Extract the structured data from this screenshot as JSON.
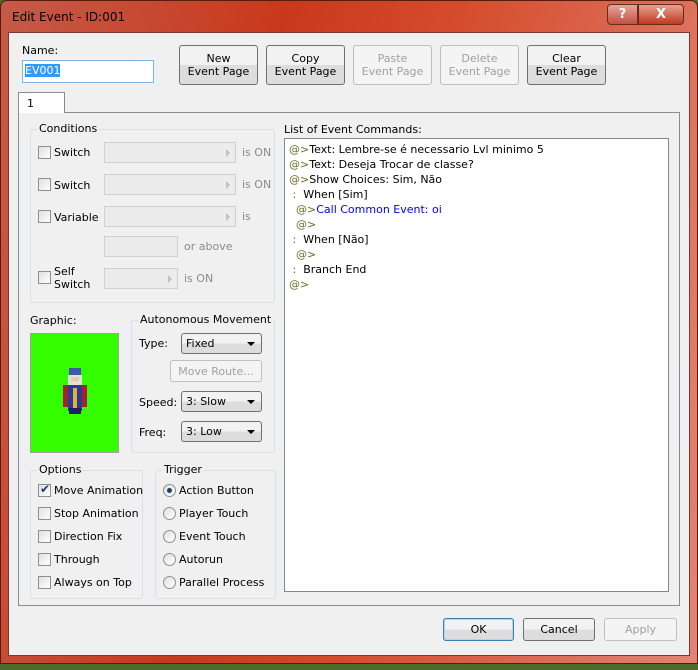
{
  "window": {
    "title": "Edit Event - ID:001",
    "help": "?",
    "close": "X"
  },
  "name": {
    "label": "Name:",
    "value": "EV001"
  },
  "toolbar": [
    {
      "l1": "New",
      "l2": "Event Page",
      "enabled": true
    },
    {
      "l1": "Copy",
      "l2": "Event Page",
      "enabled": true
    },
    {
      "l1": "Paste",
      "l2": "Event Page",
      "enabled": false
    },
    {
      "l1": "Delete",
      "l2": "Event Page",
      "enabled": false
    },
    {
      "l1": "Clear",
      "l2": "Event Page",
      "enabled": true
    }
  ],
  "tabs": [
    {
      "label": "1"
    }
  ],
  "conditions": {
    "title": "Conditions",
    "switch1": "Switch",
    "switch2": "Switch",
    "variable": "Variable",
    "is_on": "is ON",
    "is": "is",
    "or_above": "or above",
    "self_switch_1": "Self",
    "self_switch_2": "Switch"
  },
  "graphic": {
    "label": "Graphic:",
    "bg_color": "#33ff00"
  },
  "movement": {
    "title": "Autonomous Movement",
    "type_label": "Type:",
    "type": "Fixed",
    "move_route": "Move Route...",
    "speed_label": "Speed:",
    "speed": "3: Slow",
    "freq_label": "Freq:",
    "freq": "3: Low"
  },
  "options": {
    "title": "Options",
    "items": [
      {
        "label": "Move Animation",
        "checked": true
      },
      {
        "label": "Stop Animation",
        "checked": false
      },
      {
        "label": "Direction Fix",
        "checked": false
      },
      {
        "label": "Through",
        "checked": false
      },
      {
        "label": "Always on Top",
        "checked": false
      }
    ]
  },
  "trigger": {
    "title": "Trigger",
    "items": [
      {
        "label": "Action Button",
        "selected": true
      },
      {
        "label": "Player Touch",
        "selected": false
      },
      {
        "label": "Event Touch",
        "selected": false
      },
      {
        "label": "Autorun",
        "selected": false
      },
      {
        "label": "Parallel Process",
        "selected": false
      }
    ]
  },
  "commands": {
    "label": "List of Event Commands:",
    "items": [
      {
        "indent": "",
        "prefix": "@>",
        "text": "Text: Lembre-se é necessario Lvl minimo 5",
        "color": "#000000"
      },
      {
        "indent": "",
        "prefix": "@>",
        "text": "Text: Deseja Trocar de classe?",
        "color": "#000000"
      },
      {
        "indent": "",
        "prefix": "@>",
        "text": "Show Choices: Sim, Não",
        "color": "#000000"
      },
      {
        "indent": " ",
        "prefix": ":",
        "text": "  When [Sim]",
        "color": "#000000"
      },
      {
        "indent": "  ",
        "prefix": "@>",
        "text": "Call Common Event: oi",
        "color": "#0000ff"
      },
      {
        "indent": "  ",
        "prefix": "@>",
        "text": "",
        "color": "#000000"
      },
      {
        "indent": " ",
        "prefix": ":",
        "text": "  When [Não]",
        "color": "#000000"
      },
      {
        "indent": "  ",
        "prefix": "@>",
        "text": "",
        "color": "#000000"
      },
      {
        "indent": " ",
        "prefix": ":",
        "text": "  Branch End",
        "color": "#000000"
      },
      {
        "indent": "",
        "prefix": "@>",
        "text": "",
        "color": "#000000"
      }
    ]
  },
  "footer": {
    "ok": "OK",
    "cancel": "Cancel",
    "apply": "Apply"
  }
}
